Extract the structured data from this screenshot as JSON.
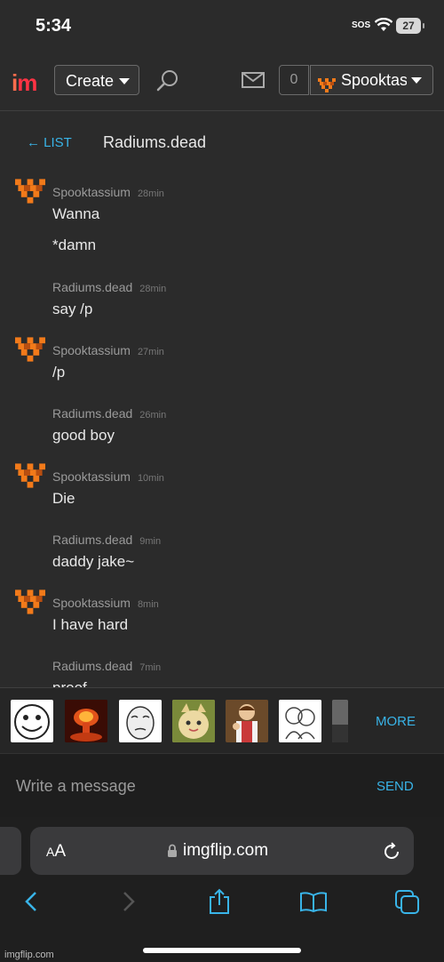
{
  "status_bar": {
    "time": "5:34",
    "sos": "SOS",
    "battery": "27"
  },
  "header": {
    "logo_i": "i",
    "logo_m": "m",
    "create_label": "Create",
    "notification_count": "0",
    "username": "Spooktas"
  },
  "conversation": {
    "back_label": "← LIST",
    "title": "Radiums.dead"
  },
  "messages": [
    {
      "author": "Spooktassium",
      "time": "28min",
      "lines": [
        "Wanna",
        "*damn"
      ]
    },
    {
      "author": "Radiums.dead",
      "time": "28min",
      "lines": [
        "say /p"
      ]
    },
    {
      "author": "Spooktassium",
      "time": "27min",
      "lines": [
        "/p"
      ]
    },
    {
      "author": "Radiums.dead",
      "time": "26min",
      "lines": [
        "good boy"
      ]
    },
    {
      "author": "Spooktassium",
      "time": "10min",
      "lines": [
        "Die"
      ]
    },
    {
      "author": "Radiums.dead",
      "time": "9min",
      "lines": [
        "daddy jake~"
      ]
    },
    {
      "author": "Spooktassium",
      "time": "8min",
      "lines": [
        "I have hard"
      ]
    },
    {
      "author": "Radiums.dead",
      "time": "7min",
      "lines": [
        "proof"
      ]
    }
  ],
  "meme_bar": {
    "more_label": "MORE"
  },
  "composer": {
    "placeholder": "Write a message",
    "send_label": "SEND"
  },
  "browser": {
    "url": "imgflip.com",
    "aa_small": "A",
    "aa_large": "A"
  },
  "watermark": "imgflip.com",
  "colors": {
    "accent": "#39b4e8",
    "avatar_orange": "#f27a1a",
    "background": "#2b2b2b"
  }
}
